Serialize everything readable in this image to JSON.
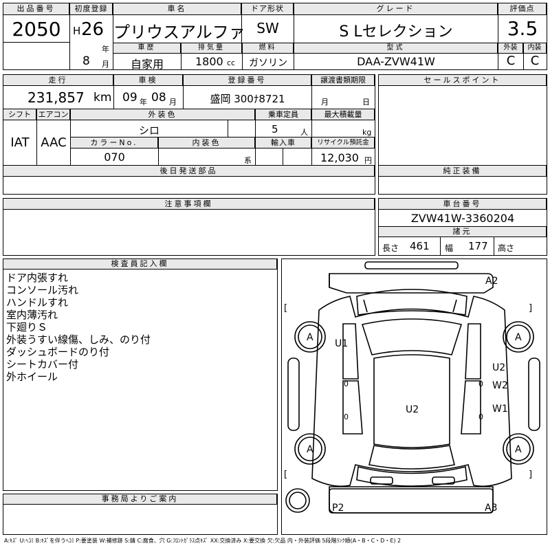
{
  "lot": {
    "label": "出品番号",
    "value": "2050"
  },
  "first_reg": {
    "label": "初度登録",
    "era": "H",
    "year": "26",
    "year_unit": "年",
    "month": "8",
    "month_unit": "月"
  },
  "car_name": {
    "label": "車名",
    "value": "プリウスアルファ"
  },
  "door": {
    "label": "ドア形状",
    "value": "SW"
  },
  "grade": {
    "label": "グレード",
    "value": "S Lセレクション"
  },
  "score": {
    "label": "評価点",
    "value": "3.5"
  },
  "history": {
    "label": "車歴",
    "value": "自家用"
  },
  "displacement": {
    "label": "排気量",
    "value": "1800",
    "unit": "cc"
  },
  "fuel": {
    "label": "燃料",
    "value": "ガソリン"
  },
  "model_code": {
    "label": "型式",
    "value": "DAA-ZVW41W"
  },
  "exterior_score": {
    "label": "外装",
    "value": "C"
  },
  "interior_score": {
    "label": "内装",
    "value": "C"
  },
  "mileage": {
    "label": "走行",
    "value": "231,857",
    "unit": "km"
  },
  "inspection": {
    "label": "車検",
    "year": "09",
    "year_unit": "年",
    "month": "08",
    "month_unit": "月"
  },
  "reg_number": {
    "label": "登録番号",
    "value": "盛岡 300ﾅ8721"
  },
  "transfer_deadline": {
    "label": "譲渡書類期限",
    "month_unit": "月",
    "day_unit": "日"
  },
  "sales_point": {
    "label": "セールスポイント"
  },
  "shift": {
    "label": "シフト",
    "value": "IAT"
  },
  "aircon": {
    "label": "エアコン",
    "value": "AAC"
  },
  "exterior_color": {
    "label": "外装色",
    "value": "シロ"
  },
  "capacity": {
    "label": "乗車定員",
    "value": "5",
    "unit": "人"
  },
  "max_load": {
    "label": "最大積載量",
    "unit": "kg"
  },
  "color_no": {
    "label": "カラーNo.",
    "value": "070"
  },
  "interior_color": {
    "label": "内装色",
    "unit": "系"
  },
  "import": {
    "label": "輸入車"
  },
  "recycle": {
    "label": "リサイクル預託金",
    "value": "12,030",
    "unit": "円"
  },
  "later_parts": {
    "label": "後日発送部品"
  },
  "genuine": {
    "label": "純正装備"
  },
  "notes": {
    "label": "注意事項欄"
  },
  "chassis": {
    "label": "車台番号",
    "value": "ZVW41W-3360204"
  },
  "specs": {
    "label": "諸元",
    "length_label": "長さ",
    "length": "461",
    "width_label": "幅",
    "width": "177",
    "height_label": "高さ"
  },
  "inspector": {
    "label": "検査員記入欄",
    "lines": [
      "ドア内張すれ",
      "コンソール汚れ",
      "ハンドルすれ",
      "室内薄汚れ",
      "下廻りＳ",
      "外装うすい線傷、しみ、のり付",
      "ダッシュボードのり付",
      "シートカバー付",
      "外ホイール"
    ]
  },
  "office": {
    "label": "事務局よりご案内"
  },
  "diagram": {
    "marks": {
      "a2": "A2",
      "u1": "U1",
      "u2_right": "U2",
      "w2": "W2",
      "w1": "W1",
      "u2_center": "U2",
      "p2": "P2",
      "a3": "A3",
      "wheel": "A",
      "zero": "0",
      "bracket_left": "[",
      "bracket_right": "]"
    }
  },
  "legend": "A:ｷｽﾞ U:ﾍｺﾐ B:ｷｽﾞを伴うﾍｺﾐ P:要塗装 W:補修跡 S:錆 C:腐食、穴 G:ﾌﾛﾝﾄｶﾞﾗｽ点ｷｽﾞ XX:交換済み X:要交換 欠:欠品 内・外装評価 5段階ﾗﾝｸ順(A・B・C・D・E) 2"
}
